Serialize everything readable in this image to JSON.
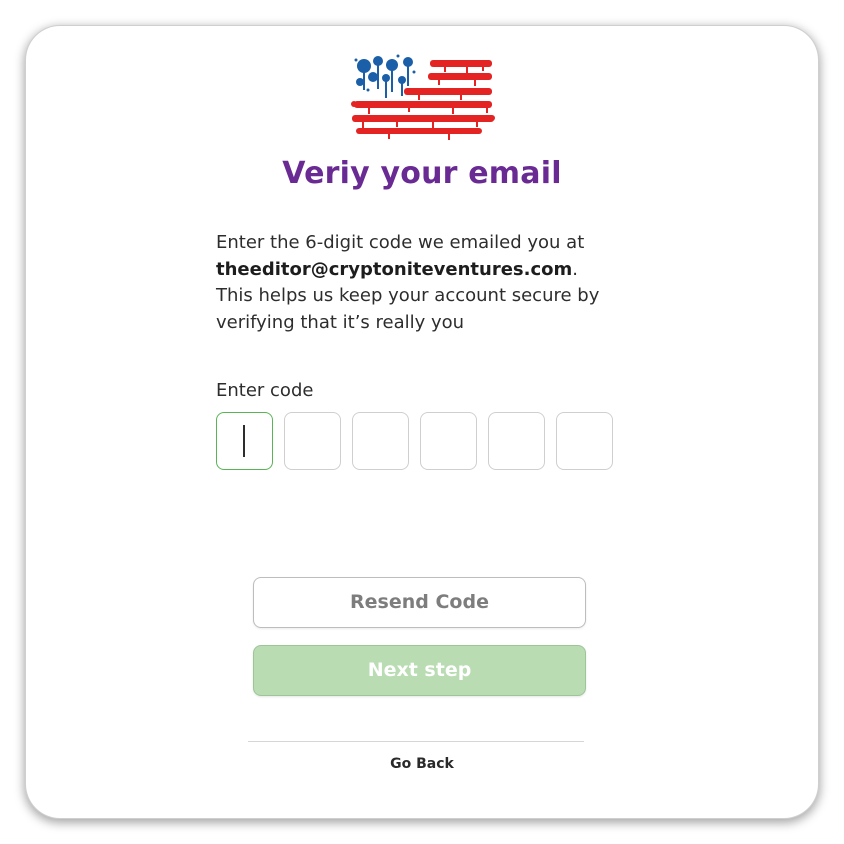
{
  "logo": {
    "icon": "spray-paint-american-flag-logo",
    "colors": {
      "blue": "#1a5fa8",
      "red": "#e32423"
    }
  },
  "title": "Veriy your email",
  "description": {
    "before": "Enter the 6-digit code we emailed you at ",
    "email": "theeditor@cryptoniteventures.com",
    "after": ". This helps us keep your account secure by verifying that it’s really you"
  },
  "code": {
    "label": "Enter code",
    "digits": [
      "",
      "",
      "",
      "",
      "",
      ""
    ]
  },
  "buttons": {
    "resend": "Resend Code",
    "next": "Next step"
  },
  "footer": {
    "go_back": "Go Back"
  },
  "colors": {
    "title": "#6a2a93",
    "active_input_border": "#59b455",
    "next_button_bg": "#b9dcb2"
  }
}
